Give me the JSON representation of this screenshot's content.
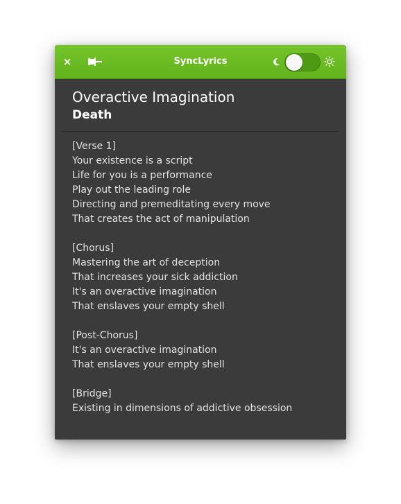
{
  "app": {
    "title": "SyncLyrics"
  },
  "controls": {
    "close_label": "×",
    "dark_mode_toggle_on": true
  },
  "song": {
    "title": "Overactive Imagination",
    "artist": "Death"
  },
  "lyrics": [
    "[Verse 1]",
    "Your existence is a script",
    "Life for you is a performance",
    "Play out the leading role",
    "Directing and premeditating every move",
    "That creates the act of manipulation",
    "",
    "[Chorus]",
    "Mastering the art of deception",
    "That increases your sick addiction",
    "It's an overactive imagination",
    "That enslaves your empty shell",
    "",
    "[Post-Chorus]",
    "It's an overactive imagination",
    "That enslaves your empty shell",
    "",
    "[Bridge]",
    "Existing in dimensions of addictive obsession"
  ],
  "colors": {
    "header_green": "#6cbc24",
    "body_background": "#3b3b3b"
  }
}
